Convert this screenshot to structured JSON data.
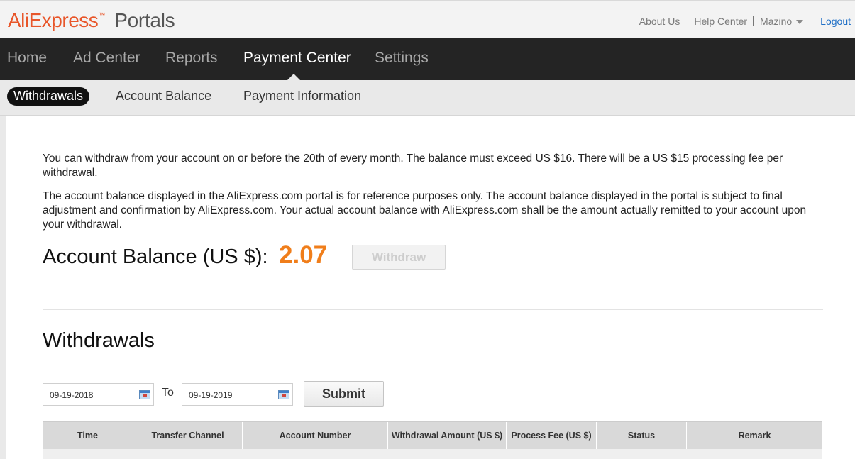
{
  "header": {
    "logo_brand": "AliExpress",
    "logo_tm": "™",
    "logo_product": "Portals",
    "links": {
      "about": "About Us",
      "help": "Help Center",
      "user": "Mazino",
      "logout": "Logout"
    }
  },
  "nav": {
    "items": [
      {
        "label": "Home"
      },
      {
        "label": "Ad Center"
      },
      {
        "label": "Reports"
      },
      {
        "label": "Payment Center"
      },
      {
        "label": "Settings"
      }
    ],
    "active": "Payment Center"
  },
  "subnav": {
    "items": [
      {
        "label": "Withdrawals"
      },
      {
        "label": "Account Balance"
      },
      {
        "label": "Payment Information"
      }
    ],
    "active": "Withdrawals"
  },
  "content": {
    "notice1": "You can withdraw from your account on or before the 20th of every month. The balance must exceed US $16. There will be a US $15 processing fee per withdrawal.",
    "notice2": "The account balance displayed in the AliExpress.com portal is for reference purposes only. The account balance displayed in the portal is subject to final adjustment and confirmation by AliExpress.com. Your actual account balance with AliExpress.com shall be the amount actually remitted to your account upon your withdrawal.",
    "balance_label": "Account Balance (US $):",
    "balance_value": "2.07",
    "withdraw_label": "Withdraw",
    "section_title": "Withdrawals",
    "filter": {
      "from_date": "09-19-2018",
      "to_label": "To",
      "to_date": "09-19-2019",
      "submit_label": "Submit"
    },
    "table": {
      "columns": [
        "Time",
        "Transfer Channel",
        "Account Number",
        "Withdrawal Amount (US $)",
        "Process Fee (US $)",
        "Status",
        "Remark"
      ]
    }
  },
  "colors": {
    "brand_orange": "#e8562a",
    "balance_orange": "#f07e1b",
    "nav_bg": "#242424",
    "link_blue": "#1f6fc6"
  }
}
